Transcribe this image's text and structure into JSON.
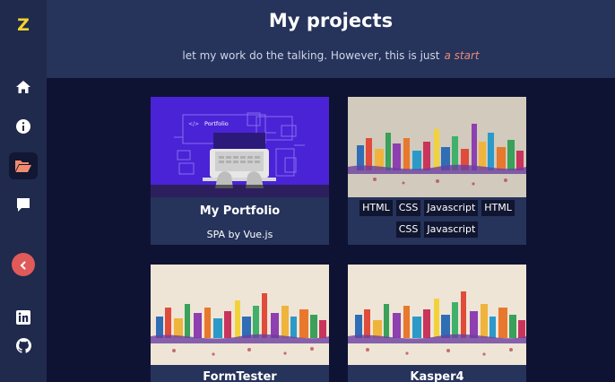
{
  "sidebar": {
    "logo": "Z",
    "items": [
      {
        "icon": "home-icon"
      },
      {
        "icon": "info-icon"
      },
      {
        "icon": "folder-open-icon",
        "active": true
      },
      {
        "icon": "chat-icon"
      }
    ],
    "collapse_icon": "chevron-left-icon",
    "social": [
      {
        "icon": "linkedin-icon"
      },
      {
        "icon": "github-icon"
      }
    ]
  },
  "header": {
    "title": "My projects",
    "subtitle": "let my work do the talking. However, this is just",
    "subtitle_accent": "a start"
  },
  "projects": [
    {
      "title": "My Portfolio",
      "subtitle": "SPA by Vue.js",
      "thumb_label": "Portfolio"
    },
    {
      "tags": [
        "HTML",
        "CSS",
        "Javascript",
        "HTML",
        "CSS",
        "Javascript"
      ]
    },
    {
      "title": "FormTester"
    },
    {
      "title": "Kasper4"
    }
  ],
  "colors": {
    "sidebar_bg": "#1f2a4d",
    "header_bg": "#26335b",
    "page_bg": "#0f1333",
    "logo": "#f6d32d",
    "accent": "#e58a77",
    "active_icon": "#f28b6c",
    "collapse_button": "#e05a5a"
  }
}
